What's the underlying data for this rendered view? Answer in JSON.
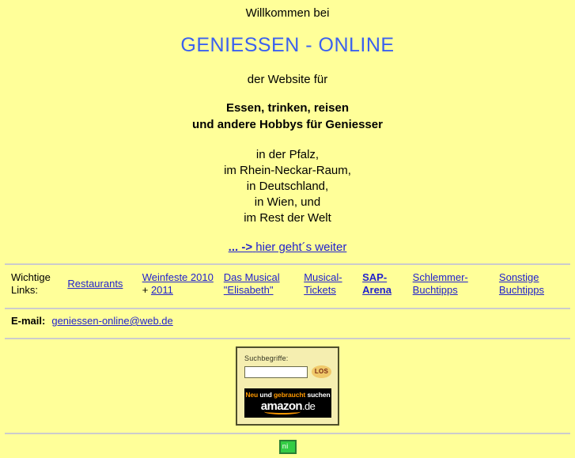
{
  "header": {
    "welcome": "Willkommen bei",
    "site_title": "GENIESSEN - ONLINE",
    "subtitle": "der Website für",
    "tagline_line1": "Essen, trinken, reisen",
    "tagline_line2": "und andere Hobbys für Geniesser",
    "places": [
      "in der Pfalz,",
      "im Rhein-Neckar-Raum,",
      "in Deutschland,",
      "in Wien, und",
      "im Rest der Welt"
    ],
    "further_link_prefix": "... ->",
    "further_link_text": "hier geht´s weiter"
  },
  "links_row": {
    "label_line1": "Wichtige",
    "label_line2": "Links:",
    "items": [
      {
        "text": "Restaurants",
        "bold": false
      },
      {
        "text": "Weinfeste 2010",
        "extra_plain": "+ ",
        "extra_link": "2011",
        "bold": false
      },
      {
        "text": "Das Musical",
        "text2": "\"Elisabeth\"",
        "bold": false
      },
      {
        "text": "Musical-",
        "text2": "Tickets",
        "bold": false
      },
      {
        "text": "SAP-",
        "text2": "Arena",
        "bold": true
      },
      {
        "text": "Schlemmer-",
        "text2": "Buchtipps",
        "bold": false
      },
      {
        "text": "Sonstige",
        "text2": "Buchtipps",
        "bold": false
      }
    ]
  },
  "email_row": {
    "label": "E-mail:",
    "address": "geniessen-online@web.de"
  },
  "amazon_widget": {
    "search_label": "Suchbegriffe:",
    "search_value": "",
    "search_placeholder": "",
    "go_button": "LOS",
    "banner_word1": "Neu",
    "banner_word2": "und",
    "banner_word3": "gebraucht",
    "banner_word4": "suchen",
    "logo": "amazon",
    "logo_suffix": ".de",
    "colors": {
      "banner_background": "#000000",
      "banner_accent": "#ff9900",
      "widget_background": "#f5eeb0",
      "widget_border": "#4f4f2a",
      "go_button": "#f0c96a"
    }
  },
  "footer": {
    "badge_glyph": "ni"
  },
  "theme": {
    "page_background": "#ffff99",
    "link_color": "#2222cc",
    "title_color": "#3b61ef",
    "rule_color": "#cccccc"
  }
}
